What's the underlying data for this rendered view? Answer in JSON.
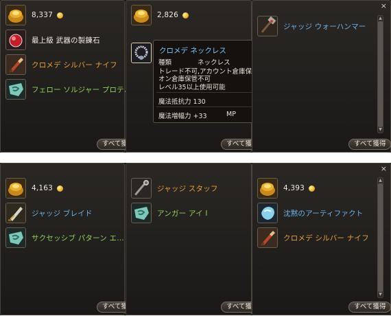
{
  "top": {
    "panel1": {
      "gold_amount": "8,337",
      "items": [
        {
          "name": "最上級 武器の製錬石",
          "color": "white"
        },
        {
          "name": "クロメデ シルバー ナイフ",
          "color": "orange"
        },
        {
          "name": "フェロー ソルジャー プロテ…",
          "color": "green"
        }
      ],
      "button_label": "すべて獲"
    },
    "panel2": {
      "gold_amount": "2,826",
      "button_label": "すべて獲"
    },
    "panel3": {
      "items": [
        {
          "name": "ジャッジ ウォーハンマー",
          "color": "blue"
        }
      ],
      "button_label": "すべて獲得",
      "close_symbol": "×"
    },
    "tooltip": {
      "title": "クロメデ ネックレス",
      "type_label": "種類",
      "type_value": "ネックレス",
      "lines": [
        "トレード不可,アカウント倉庫保管",
        "オン倉庫保管不可",
        "レベル35以上使用可能"
      ],
      "stat1": "魔法抵抗力 130",
      "stat2_label": "魔法増幅力 +33",
      "stat2_extra": "MP"
    }
  },
  "bottom": {
    "panel1": {
      "gold_amount": "4,163",
      "items": [
        {
          "name": "ジャッジ ブレイド",
          "color": "blue"
        },
        {
          "name": "サクセッシブ パターン エ…",
          "color": "green"
        }
      ],
      "button_label": "すべて獲"
    },
    "panel2": {
      "items": [
        {
          "name": "ジャッジ スタッフ",
          "color": "orange"
        },
        {
          "name": "アンガー アイ I",
          "color": "green"
        }
      ],
      "button_label": "すべて獲"
    },
    "panel3": {
      "gold_amount": "4,393",
      "items": [
        {
          "name": "沈黙のアーティファクト",
          "color": "blue"
        },
        {
          "name": "クロメデ シルバー ナイフ",
          "color": "orange"
        }
      ],
      "button_label": "すべて獲得",
      "close_symbol": "×"
    }
  },
  "colors": {
    "white": "#f0ebe0",
    "orange": "#e8a23a",
    "green": "#8fd35a",
    "blue": "#6ab4ef"
  },
  "icons": [
    "gold-bag-icon",
    "red-gem-icon",
    "knife-icon",
    "green-stone-icon",
    "necklace-icon",
    "warhammer-icon",
    "blade-icon",
    "staff-icon",
    "blue-crystal-icon"
  ]
}
